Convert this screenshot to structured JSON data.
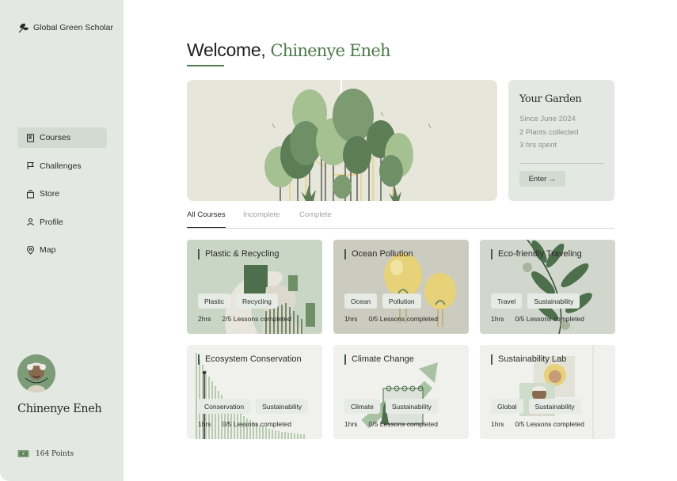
{
  "app": {
    "brand": "Global Green Scholar"
  },
  "sidebar": {
    "items": [
      {
        "label": "Courses",
        "icon": "book-icon",
        "active": true
      },
      {
        "label": "Challenges",
        "icon": "flag-icon",
        "active": false
      },
      {
        "label": "Store",
        "icon": "shopping-bag-icon",
        "active": false
      },
      {
        "label": "Profile",
        "icon": "user-icon",
        "active": false
      },
      {
        "label": "Map",
        "icon": "map-pin-icon",
        "active": false
      }
    ],
    "user_name": "Chinenye Eneh",
    "points": "164 Points"
  },
  "header": {
    "greeting": "Welcome,",
    "name": "Chinenye Eneh"
  },
  "garden": {
    "title": "Your Garden",
    "since": "Since June 2024",
    "plants": "2 Plants collected",
    "hours": "3 hrs spent",
    "enter_label": "Enter →"
  },
  "tabs": [
    {
      "label": "All Courses",
      "active": true
    },
    {
      "label": "Incomplete",
      "active": false
    },
    {
      "label": "Complete",
      "active": false
    }
  ],
  "courses": [
    {
      "title": "Plastic & Recycling",
      "tags": [
        "Plastic",
        "Recycling"
      ],
      "hours": "2hrs",
      "progress": "2/5 Lessons completed",
      "bg": "#c9d6c6"
    },
    {
      "title": "Ocean Pollution",
      "tags": [
        "Ocean",
        "Pollution"
      ],
      "hours": "1hrs",
      "progress": "0/5 Lessons completed",
      "bg": "#cbcbbf"
    },
    {
      "title": "Eco-friendly Traveling",
      "tags": [
        "Travel",
        "Sustainability"
      ],
      "hours": "1hrs",
      "progress": "0/5 Lessons completed",
      "bg": "#d1d7cd"
    },
    {
      "title": "Ecosystem Conservation",
      "tags": [
        "Conservation",
        "Sustainability"
      ],
      "hours": "1hrs",
      "progress": "0/5 Lessons completed",
      "bg": "#f0f0ec"
    },
    {
      "title": "Climate Change",
      "tags": [
        "Climate",
        "Sustainability"
      ],
      "hours": "1hrs",
      "progress": "0/5 Lessons completed",
      "bg": "#f0f0ec"
    },
    {
      "title": "Sustainability Lab",
      "tags": [
        "Global",
        "Sustainability"
      ],
      "hours": "1hrs",
      "progress": "0/5 Lessons completed",
      "bg": "#f0f0ec"
    }
  ],
  "colors": {
    "accent": "#4f7a4e",
    "sidebar_bg": "#e3e9e2",
    "active_nav": "#d2dbd1"
  }
}
